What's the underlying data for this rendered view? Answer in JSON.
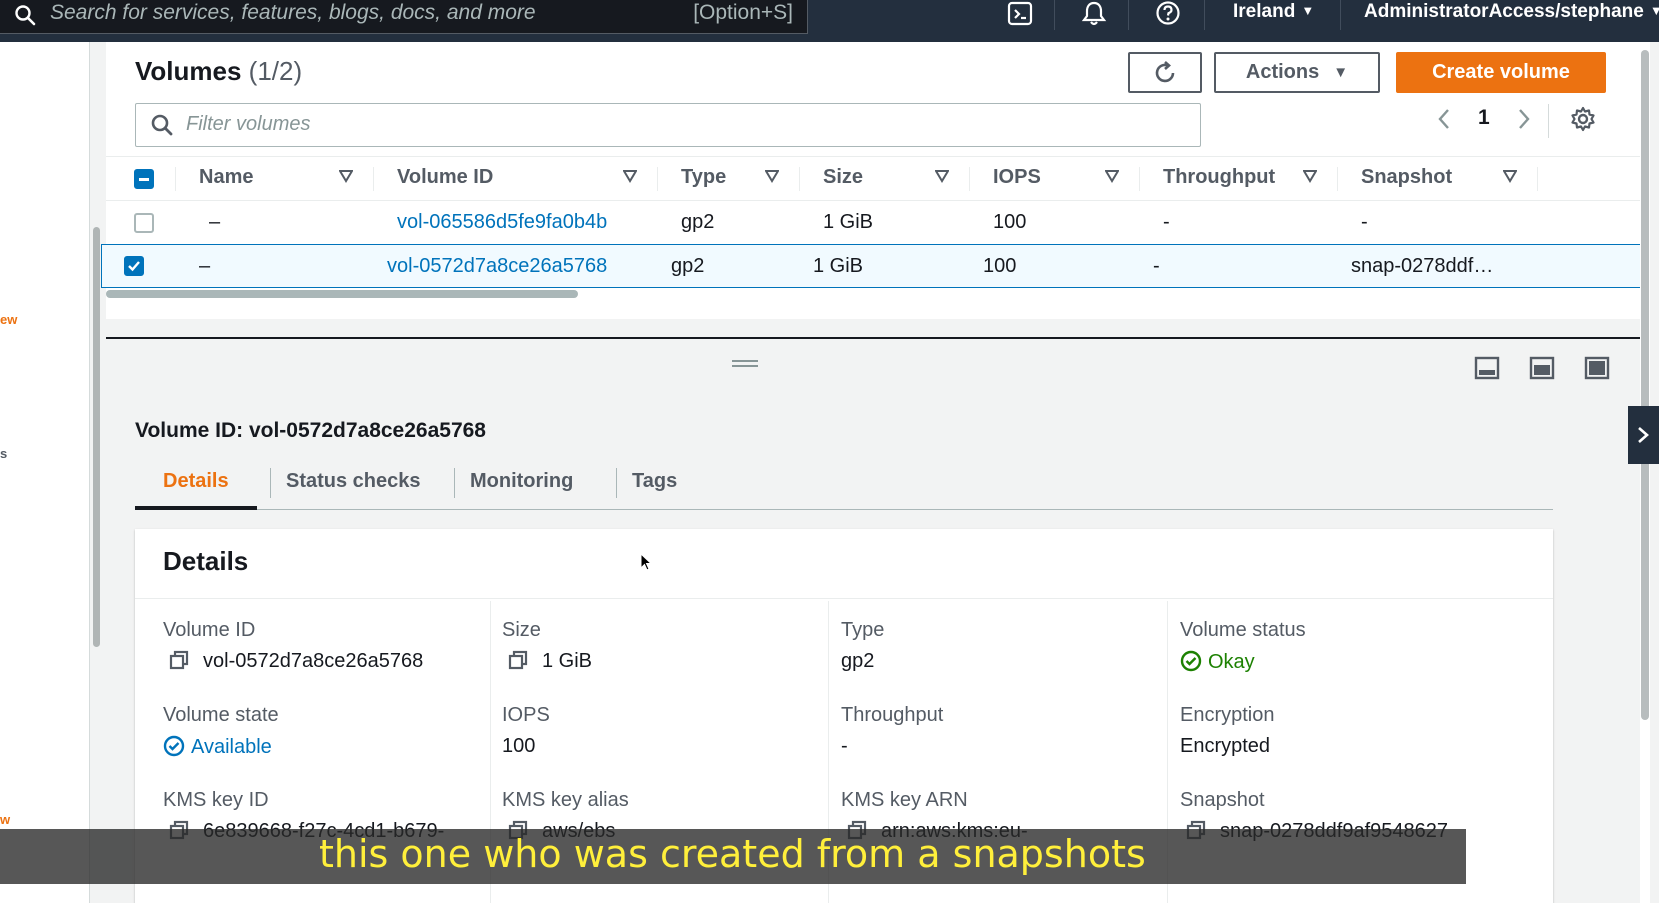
{
  "topnav": {
    "search_placeholder": "Search for services, features, blogs, docs, and more",
    "search_shortcut": "[Option+S]",
    "region": "Ireland",
    "account": "AdministratorAccess/stephane"
  },
  "sidenav": {
    "frag1": "ew",
    "frag2": "s",
    "frag3": "w"
  },
  "volumes": {
    "title": "Volumes",
    "count": "(1/2)",
    "actions_label": "Actions",
    "create_label": "Create volume",
    "filter_placeholder": "Filter volumes",
    "page": "1",
    "columns": [
      "Name",
      "Volume ID",
      "Type",
      "Size",
      "IOPS",
      "Throughput",
      "Snapshot"
    ],
    "rows": [
      {
        "name": "–",
        "volume_id": "vol-065586d5fe9fa0b4b",
        "type": "gp2",
        "size": "1 GiB",
        "iops": "100",
        "throughput": "-",
        "snapshot": "-",
        "selected": false
      },
      {
        "name": "–",
        "volume_id": "vol-0572d7a8ce26a5768",
        "type": "gp2",
        "size": "1 GiB",
        "iops": "100",
        "throughput": "-",
        "snapshot": "snap-0278ddf…",
        "selected": true
      }
    ]
  },
  "detail": {
    "title": "Volume ID: vol-0572d7a8ce26a5768",
    "tabs": [
      "Details",
      "Status checks",
      "Monitoring",
      "Tags"
    ],
    "active_tab": "Details",
    "card_title": "Details",
    "fields": {
      "volume_id_label": "Volume ID",
      "volume_id_value": "vol-0572d7a8ce26a5768",
      "size_label": "Size",
      "size_value": "1 GiB",
      "type_label": "Type",
      "type_value": "gp2",
      "status_label": "Volume status",
      "status_value": "Okay",
      "state_label": "Volume state",
      "state_value": "Available",
      "iops_label": "IOPS",
      "iops_value": "100",
      "throughput_label": "Throughput",
      "throughput_value": "-",
      "encryption_label": "Encryption",
      "encryption_value": "Encrypted",
      "kms_id_label": "KMS key ID",
      "kms_id_value": "6e839668-f27c-4cd1-b679-",
      "kms_alias_label": "KMS key alias",
      "kms_alias_value": "aws/ebs",
      "kms_arn_label": "KMS key ARN",
      "kms_arn_value": "arn:aws:kms:eu-",
      "snapshot_label": "Snapshot",
      "snapshot_value": "snap-0278ddf9af9548627"
    }
  },
  "caption": "this one who was created from a snapshots",
  "colors": {
    "accent": "#ec7211",
    "link": "#0073bb",
    "nav_bg": "#232f3e",
    "ok": "#1d8102",
    "caption_text": "#ffef3b"
  }
}
